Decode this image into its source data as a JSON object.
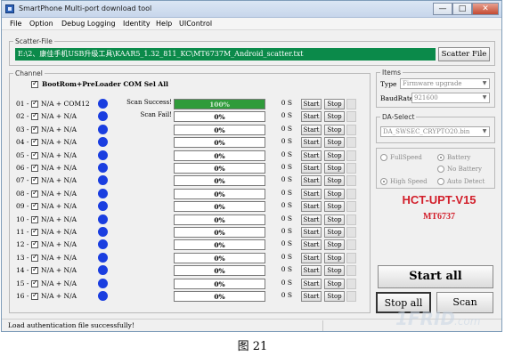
{
  "window": {
    "title": "SmartPhone Multi-port download tool",
    "controls": {
      "min": "—",
      "max": "□",
      "close": "✕"
    }
  },
  "menu": [
    "File",
    "Option",
    "Debug Logging",
    "Identity",
    "Help",
    "UIControl"
  ],
  "scatter": {
    "group_title": "Scatter-File",
    "path": "E:\\2、康佳手机USB升级工具\\KAAR5_1.32_811_KC\\MT6737M_Android_scatter.txt",
    "button": "Scatter File"
  },
  "channel": {
    "group_title": "Channel",
    "select_all_label": "BootRom+PreLoader COM Sel All",
    "rows": [
      {
        "index": "01 -",
        "port": "N/A + COM12",
        "status": "Scan Success!",
        "progress": "100%",
        "progress_value": 100,
        "time": "0 S"
      },
      {
        "index": "02 -",
        "port": "N/A + N/A",
        "status": "Scan Fail!",
        "progress": "0%",
        "progress_value": 0,
        "time": "0 S"
      },
      {
        "index": "03 -",
        "port": "N/A + N/A",
        "status": "",
        "progress": "0%",
        "progress_value": 0,
        "time": "0 S"
      },
      {
        "index": "04 -",
        "port": "N/A + N/A",
        "status": "",
        "progress": "0%",
        "progress_value": 0,
        "time": "0 S"
      },
      {
        "index": "05 -",
        "port": "N/A + N/A",
        "status": "",
        "progress": "0%",
        "progress_value": 0,
        "time": "0 S"
      },
      {
        "index": "06 -",
        "port": "N/A + N/A",
        "status": "",
        "progress": "0%",
        "progress_value": 0,
        "time": "0 S"
      },
      {
        "index": "07 -",
        "port": "N/A + N/A",
        "status": "",
        "progress": "0%",
        "progress_value": 0,
        "time": "0 S"
      },
      {
        "index": "08 -",
        "port": "N/A + N/A",
        "status": "",
        "progress": "0%",
        "progress_value": 0,
        "time": "0 S"
      },
      {
        "index": "09 -",
        "port": "N/A + N/A",
        "status": "",
        "progress": "0%",
        "progress_value": 0,
        "time": "0 S"
      },
      {
        "index": "10 -",
        "port": "N/A + N/A",
        "status": "",
        "progress": "0%",
        "progress_value": 0,
        "time": "0 S"
      },
      {
        "index": "11 -",
        "port": "N/A + N/A",
        "status": "",
        "progress": "0%",
        "progress_value": 0,
        "time": "0 S"
      },
      {
        "index": "12 -",
        "port": "N/A + N/A",
        "status": "",
        "progress": "0%",
        "progress_value": 0,
        "time": "0 S"
      },
      {
        "index": "13 -",
        "port": "N/A + N/A",
        "status": "",
        "progress": "0%",
        "progress_value": 0,
        "time": "0 S"
      },
      {
        "index": "14 -",
        "port": "N/A + N/A",
        "status": "",
        "progress": "0%",
        "progress_value": 0,
        "time": "0 S"
      },
      {
        "index": "15 -",
        "port": "N/A + N/A",
        "status": "",
        "progress": "0%",
        "progress_value": 0,
        "time": "0 S"
      },
      {
        "index": "16 -",
        "port": "N/A + N/A",
        "status": "",
        "progress": "0%",
        "progress_value": 0,
        "time": "0 S"
      }
    ],
    "start_label": "Start",
    "stop_label": "Stop",
    "port_dot_color": "#1a3ee0",
    "progress_fill_color": "#2f9b3a"
  },
  "items": {
    "group_title": "Items",
    "type_label": "Type",
    "type_value": "Firmware upgrade",
    "baud_label": "BaudRate",
    "baud_value": "921600"
  },
  "da_select": {
    "group_title": "DA-Select",
    "value": "DA_SWSEC_CRYPTO20.bin"
  },
  "speed": {
    "full": "FullSpeed",
    "high": "High Speed",
    "battery": "Battery",
    "no_battery": "No Battery",
    "auto_detect": "Auto Detect"
  },
  "brand": {
    "line1": "HCT-UPT-V15",
    "line2": "MT6737",
    "color": "#d21e2a"
  },
  "actions": {
    "start_all": "Start all",
    "stop_all": "Stop all",
    "scan": "Scan"
  },
  "status_bar": {
    "message": "Load authentication file successfully!"
  },
  "caption": "图 21"
}
